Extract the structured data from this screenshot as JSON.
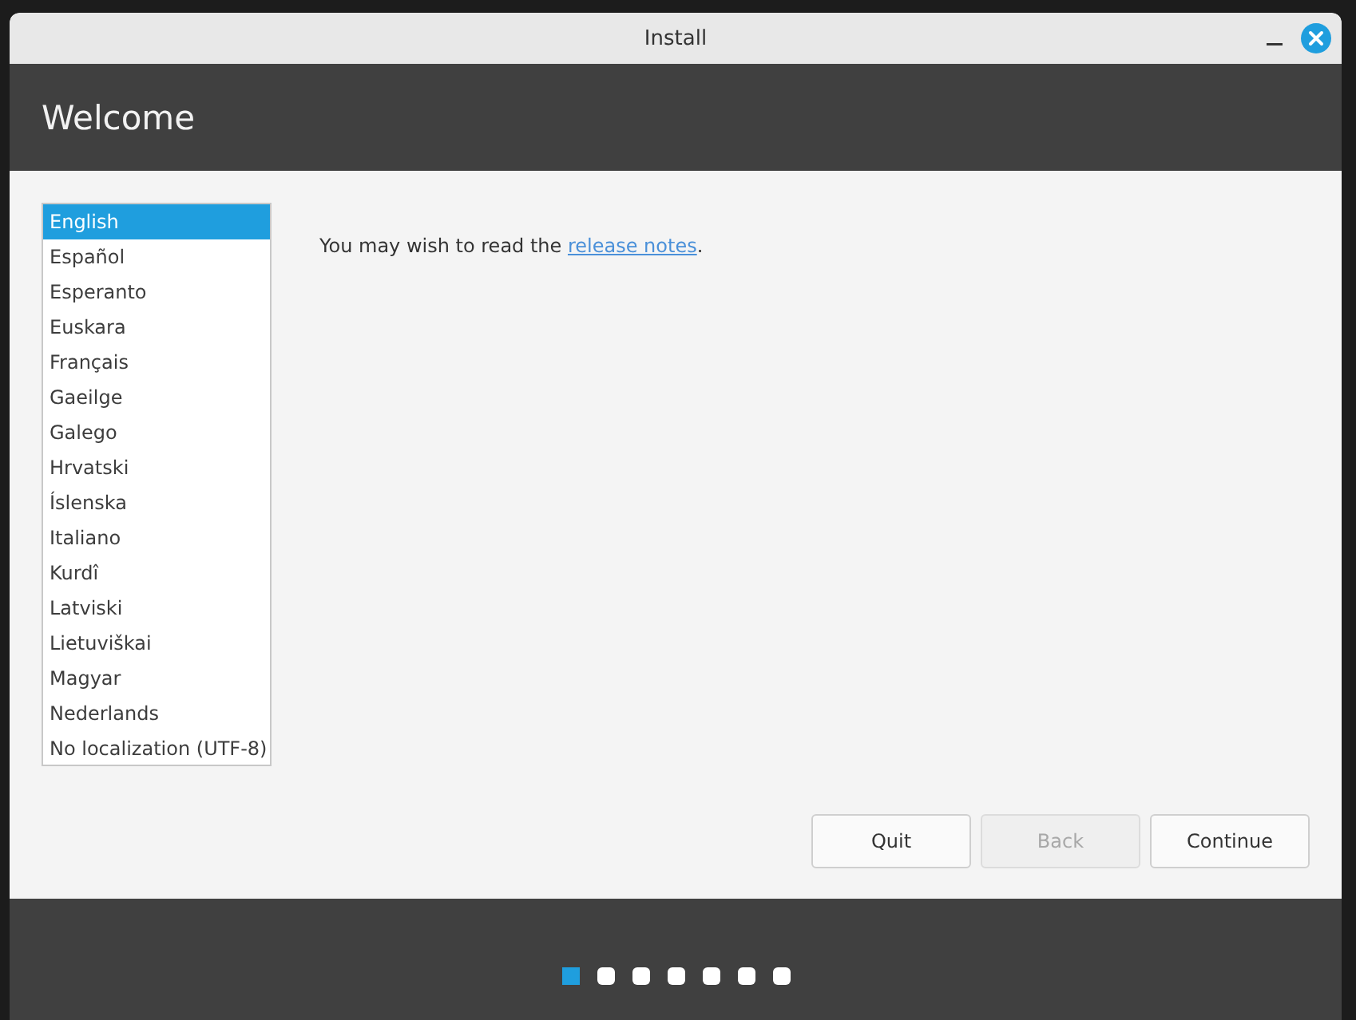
{
  "window": {
    "title": "Install"
  },
  "header": {
    "title": "Welcome"
  },
  "languages": [
    {
      "label": "English",
      "selected": true
    },
    {
      "label": "Español",
      "selected": false
    },
    {
      "label": "Esperanto",
      "selected": false
    },
    {
      "label": "Euskara",
      "selected": false
    },
    {
      "label": "Français",
      "selected": false
    },
    {
      "label": "Gaeilge",
      "selected": false
    },
    {
      "label": "Galego",
      "selected": false
    },
    {
      "label": "Hrvatski",
      "selected": false
    },
    {
      "label": "Íslenska",
      "selected": false
    },
    {
      "label": "Italiano",
      "selected": false
    },
    {
      "label": "Kurdî",
      "selected": false
    },
    {
      "label": "Latviski",
      "selected": false
    },
    {
      "label": "Lietuviškai",
      "selected": false
    },
    {
      "label": "Magyar",
      "selected": false
    },
    {
      "label": "Nederlands",
      "selected": false
    },
    {
      "label": "No localization (UTF-8)",
      "selected": false
    }
  ],
  "intro": {
    "before": "You may wish to read the ",
    "link": "release notes",
    "after": "."
  },
  "buttons": [
    {
      "label": "Quit",
      "disabled": false
    },
    {
      "label": "Back",
      "disabled": true
    },
    {
      "label": "Continue",
      "disabled": false
    }
  ],
  "steps": [
    {
      "selected": true
    },
    {
      "selected": false
    },
    {
      "selected": false
    },
    {
      "selected": false
    },
    {
      "selected": false
    },
    {
      "selected": false
    },
    {
      "selected": false
    }
  ]
}
